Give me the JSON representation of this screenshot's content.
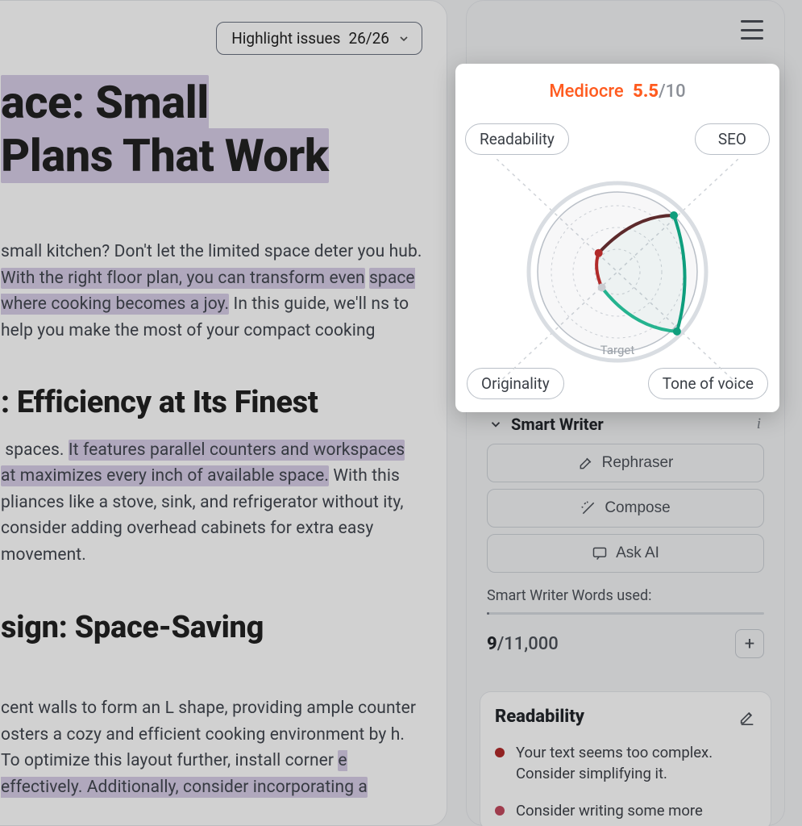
{
  "toolbar": {
    "highlight_label": "Highlight issues",
    "highlight_count": "26/26"
  },
  "document": {
    "title_html": "<mark class='hl'>ace: Small</mark><br><mark class='hl'>Plans That Work</mark>",
    "intro_html": "small kitchen? Don't let the limited space deter you hub. <mark class='hl'>With the right floor plan, you can transform even</mark> <mark class='hl'>space where cooking becomes a joy.</mark> In this guide, we'll ns to help you make the most of your compact cooking",
    "h2_a": ": Efficiency at Its Finest",
    "para_a_html": "&nbsp;spaces. <mark class='hl'>It features parallel counters and workspaces</mark> <mark class='hl'>at maximizes every inch of available space.</mark> With this pliances like a stove, sink, and refrigerator without ity, consider adding overhead cabinets for extra easy movement.",
    "h2_b": "sign: Space-Saving",
    "para_b_html": "cent walls to form an L shape, providing ample counter osters a cozy and efficient cooking environment by h. To optimize this layout further, install corner <mark class='hl'>e effectively. Additionally, consider incorporating a</mark>"
  },
  "score": {
    "word": "Mediocre",
    "value": "5.5",
    "max": "/10",
    "pills": {
      "readability": "Readability",
      "seo": "SEO",
      "originality": "Originality",
      "tone": "Tone of voice"
    },
    "target_label": "Target"
  },
  "chart_data": {
    "type": "radar",
    "axes": [
      "Readability",
      "SEO",
      "Tone of voice",
      "Originality"
    ],
    "max": 10,
    "target": 9,
    "values": {
      "Readability": 3.0,
      "SEO": 9.0,
      "Tone of voice": 9.5,
      "Originality": 2.5
    },
    "rings": [
      2.5,
      5.0,
      7.5,
      10.0
    ]
  },
  "smart_writer": {
    "title": "Smart Writer",
    "buttons": {
      "rephraser": "Rephraser",
      "compose": "Compose",
      "ask": "Ask AI"
    },
    "usage_label": "Smart Writer Words used:",
    "used": "9",
    "limit": "/11,000"
  },
  "readability": {
    "title": "Readability",
    "items": [
      "Your text seems too complex. Consider simplifying it.",
      "Consider writing some more"
    ]
  }
}
